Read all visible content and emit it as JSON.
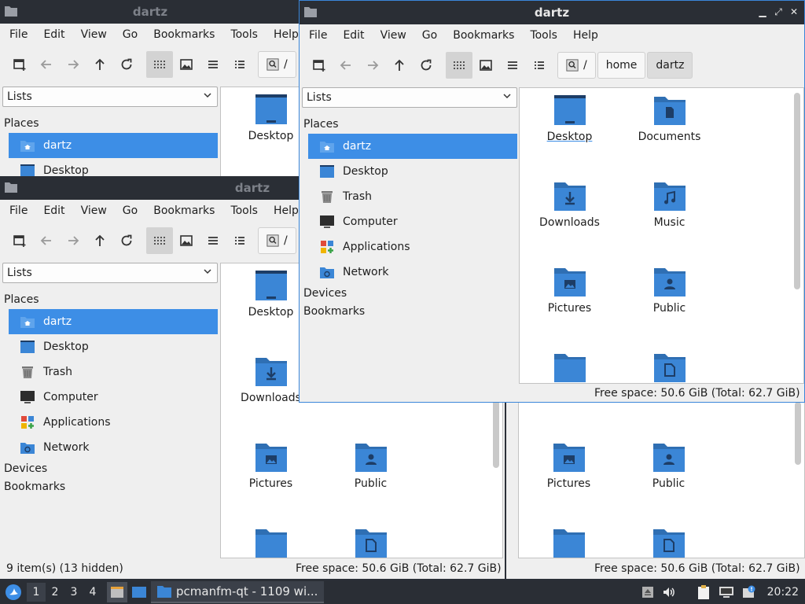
{
  "colors": {
    "accent": "#3d8ee6",
    "folder": "#3b86d6",
    "folder_tab": "#2f6fb3",
    "titlebar": "#2a2e35"
  },
  "windows": [
    {
      "title": "dartz"
    },
    {
      "title": "dartz"
    },
    {
      "title": "dartz"
    }
  ],
  "menu": [
    "File",
    "Edit",
    "View",
    "Go",
    "Bookmarks",
    "Tools",
    "Help"
  ],
  "menu_partial_help": "Help",
  "path": {
    "root": "/",
    "crumbs": [
      "home",
      "dartz"
    ]
  },
  "sidebar": {
    "combo": "Lists",
    "places_header": "Places",
    "places": [
      {
        "label": "dartz",
        "icon": "home-folder-icon"
      },
      {
        "label": "Desktop",
        "icon": "desktop-icon"
      },
      {
        "label": "Trash",
        "icon": "trash-icon"
      },
      {
        "label": "Computer",
        "icon": "computer-icon"
      },
      {
        "label": "Applications",
        "icon": "applications-icon"
      },
      {
        "label": "Network",
        "icon": "network-icon"
      }
    ],
    "devices_header": "Devices",
    "bookmarks_header": "Bookmarks"
  },
  "files": [
    {
      "label": "Desktop",
      "icon": "desktop-folder-icon"
    },
    {
      "label": "Documents",
      "icon": "documents-folder-icon"
    },
    {
      "label": "Downloads",
      "icon": "downloads-folder-icon"
    },
    {
      "label": "Music",
      "icon": "music-folder-icon"
    },
    {
      "label": "Pictures",
      "icon": "pictures-folder-icon"
    },
    {
      "label": "Public",
      "icon": "public-folder-icon"
    },
    {
      "label": "",
      "icon": "folder-icon"
    },
    {
      "label": "",
      "icon": "templates-folder-icon"
    }
  ],
  "status": {
    "items": "9 item(s) (13 hidden)",
    "free": "Free space: 50.6 GiB (Total: 62.7 GiB)"
  },
  "taskbar": {
    "workspaces": [
      "1",
      "2",
      "3",
      "4"
    ],
    "task_label": "pcmanfm-qt - 1109 wi...",
    "clock": "20:22"
  }
}
